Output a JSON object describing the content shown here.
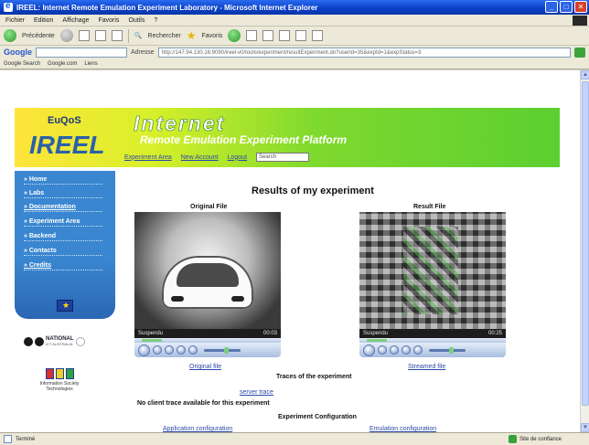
{
  "window": {
    "title": "IREEL: Internet Remote Emulation Experiment Laboratory - Microsoft Internet Explorer"
  },
  "menubar": {
    "items": [
      "Fichier",
      "Edition",
      "Affichage",
      "Favoris",
      "Outils",
      "?"
    ]
  },
  "toolbar": {
    "back_label": "Précédente",
    "search_label": "Rechercher",
    "favorites_label": "Favoris"
  },
  "addressbar": {
    "google_label": "Google",
    "address_label": "Adresse",
    "url": "http://147.94.130.16:9090/ireel-v0/tools/experiment/resultExperiment.do?userId=35&expId=1&expStatus=3"
  },
  "linksbar": {
    "items": [
      "Google Search",
      "Google.com",
      "Liens"
    ]
  },
  "site": {
    "euqos": "EuQoS",
    "ireel": "IREEL",
    "internet": "Internet",
    "subtitle": "Remote Emulation Experiment Platform",
    "nav": [
      "Experiment Area",
      "New Account",
      "Logout"
    ],
    "search_placeholder": "Search"
  },
  "sidebar": {
    "items": [
      {
        "label": "Home"
      },
      {
        "label": "Labs"
      },
      {
        "label": "Documentation"
      },
      {
        "label": "Experiment Area"
      },
      {
        "label": "Backend"
      },
      {
        "label": "Contacts"
      },
      {
        "label": "Credits"
      }
    ]
  },
  "logos": {
    "national": "NATIONAL",
    "national_sub": "ICT AUSTRALIA",
    "info_society": "Information Society Technologies"
  },
  "main": {
    "title": "Results of my experiment",
    "original_label": "Original File",
    "result_label": "Result File",
    "original_status": "Suspendu",
    "original_time": "00:03",
    "result_status": "Suspendu",
    "result_time": "00:25",
    "original_link": "Original file",
    "result_link": "Streamed file",
    "traces_title": "Traces of the experiment",
    "server_trace": "server trace",
    "no_client_trace": "No client trace available for this experiment",
    "config_title": "Experiment Configuration",
    "application_config": "Application configuration",
    "emulation_config": "Emulation configuration"
  },
  "statusbar": {
    "left": "Terminé",
    "zone": "Site de confiance"
  },
  "colors": {
    "banner_green": "#5ccf31",
    "banner_yellow": "#ffe43a",
    "sidebar_blue": "#3a86d0",
    "link_blue": "#2a4aa8"
  }
}
